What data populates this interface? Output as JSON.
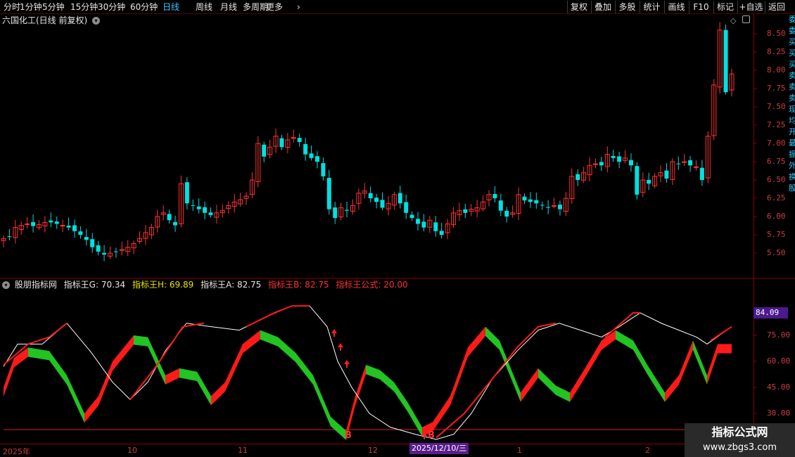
{
  "toolbar": {
    "periods": [
      "分时",
      "1分钟",
      "5分钟",
      "15分钟",
      "30分钟",
      "60分钟",
      "日线",
      "周线",
      "月线",
      "多周期",
      "更多"
    ],
    "active_period": "日线",
    "right_buttons": [
      "复权",
      "叠加",
      "多股",
      "统计",
      "画线",
      "F10",
      "标记",
      "+自选",
      "返回"
    ]
  },
  "main_panel": {
    "title": "六国化工(日线 前复权)",
    "price_axis": [
      "8.50",
      "8.25",
      "8.00",
      "7.75",
      "7.50",
      "7.25",
      "7.00",
      "6.75",
      "6.50",
      "6.25",
      "6.00",
      "5.75",
      "5.50"
    ]
  },
  "indicator_panel": {
    "name": "股朋指标网",
    "values": [
      {
        "label": "指标王G: 70.34",
        "color": "#e6e6e6"
      },
      {
        "label": "指标王H: 69.89",
        "color": "#e6e600"
      },
      {
        "label": "指标王A: 82.75",
        "color": "#e6e6e6"
      },
      {
        "label": "指标王B: 82.75",
        "color": "#ff3232"
      },
      {
        "label": "指标王公式: 20.00",
        "color": "#ff3232"
      }
    ],
    "current_tag": "84.09",
    "axis": [
      "75.00",
      "60.00",
      "45.00",
      "30.00"
    ],
    "signals": [
      "B",
      "B"
    ]
  },
  "time_axis": {
    "labels": [
      "2025年",
      "10",
      "11",
      "12",
      "1",
      "2"
    ],
    "cursor_date": "2025/12/10/三"
  },
  "watermark": {
    "title": "指标公式网",
    "url": "www.zbgs3.com"
  },
  "colors": {
    "up": "#ff3232",
    "down": "#00e0e0",
    "bull_band": "#ff1a1a",
    "bear_band": "#22c322",
    "line_white": "#ffffff",
    "grid": "#8b0000"
  }
}
